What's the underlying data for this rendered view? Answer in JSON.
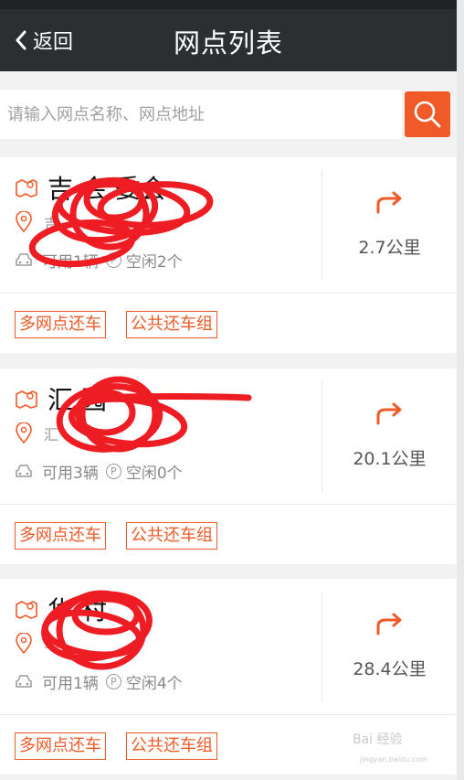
{
  "header": {
    "back_label": "返回",
    "title": "网点列表"
  },
  "search": {
    "placeholder": "请输入网点名称、网点地址"
  },
  "colors": {
    "accent": "#f05a28",
    "header_bg": "#2b2f31",
    "scribble": "#ee1d23"
  },
  "stations": [
    {
      "name": "吉   会   委会",
      "address": "吉",
      "available": "可用1辆",
      "parking": "空闲2个",
      "distance": "2.7公里",
      "tags": [
        "多网点还车",
        "公共还车组"
      ]
    },
    {
      "name": "汇        园",
      "address": "汇",
      "available": "可用3辆",
      "parking": "空闲0个",
      "distance": "20.1公里",
      "tags": [
        "多网点还车",
        "公共还车组"
      ]
    },
    {
      "name": "华      村",
      "address": "华",
      "available": "可用1辆",
      "parking": "空闲4个",
      "distance": "28.4公里",
      "tags": [
        "多网点还车",
        "公共还车组"
      ]
    }
  ],
  "icons": {
    "back": "chevron-left-icon",
    "search": "search-icon",
    "station": "map-icon",
    "location": "location-pin-icon",
    "car": "car-icon",
    "parking": "parking-icon",
    "navigate": "turn-right-arrow-icon"
  },
  "watermark": {
    "text": "Bai 经验",
    "sub": "jingyan.baidu.com"
  }
}
